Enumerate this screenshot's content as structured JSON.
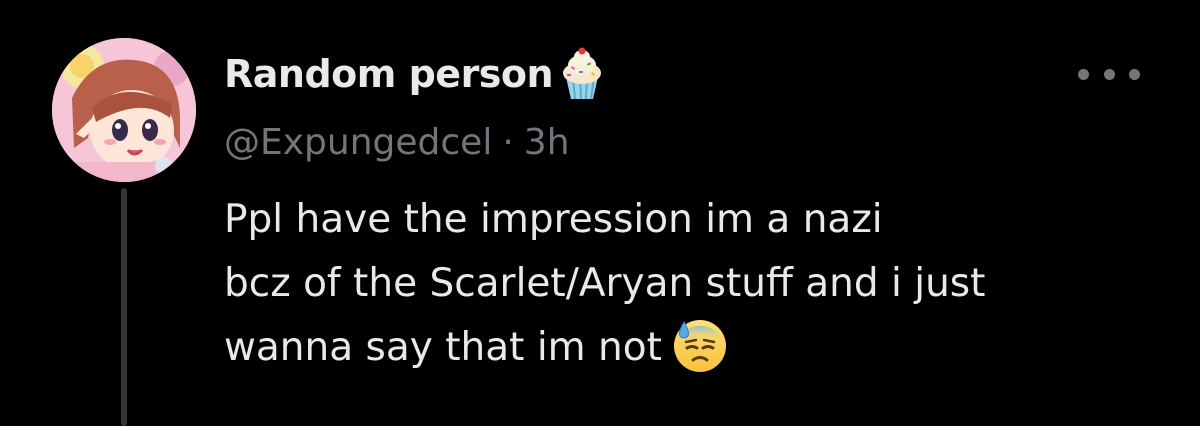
{
  "author": {
    "display_name": "Random person",
    "name_badge_icon": "cupcake-icon",
    "handle": "@Expungedcel",
    "separator": "·",
    "timestamp": "3h"
  },
  "menu": {
    "more_icon": "more-horizontal-icon"
  },
  "tweet": {
    "lines": [
      "Ppl have the impression im a nazi",
      "bcz of the Scarlet/Aryan stuff and i just",
      "wanna say that im not"
    ],
    "trailing_emoji_icon": "downcast-face-with-sweat-icon"
  },
  "colors": {
    "background": "#000000",
    "primary_text": "#e7e9ea",
    "secondary_text": "#71767b",
    "thread_line": "#333639"
  }
}
